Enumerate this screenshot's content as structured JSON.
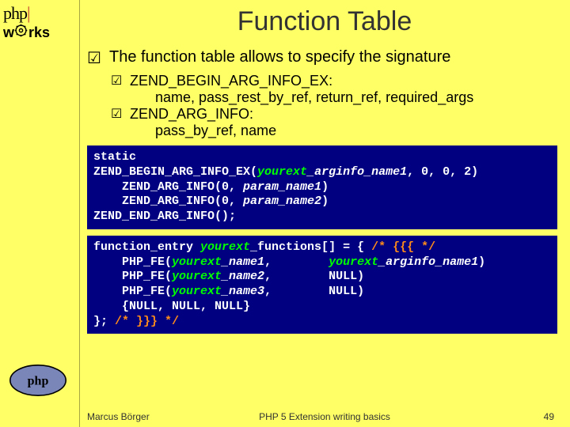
{
  "header": {
    "logo_php": "php",
    "logo_pipe": "|",
    "logo_works": "rks"
  },
  "title": "Function Table",
  "main_point": "The function table allows to specify the signature",
  "sub_points": [
    {
      "head": "ZEND_BEGIN_ARG_INFO_EX:",
      "detail": "name, pass_rest_by_ref, return_ref, required_args"
    },
    {
      "head": "ZEND_ARG_INFO:",
      "detail": "pass_by_ref, name"
    }
  ],
  "code1": {
    "l1": "static",
    "l2a": "ZEND_BEGIN_ARG_INFO_EX(",
    "l2b": "yourext",
    "l2c": "_arginfo_name1",
    "l2d": ", 0, 0, 2)",
    "l3a": "    ZEND_ARG_INFO(0, ",
    "l3b": "param_name1",
    "l3c": ")",
    "l4a": "    ZEND_ARG_INFO(0, ",
    "l4b": "param_name2",
    "l4c": ")",
    "l5": "ZEND_END_ARG_INFO();"
  },
  "code2": {
    "l1a": "function_entry ",
    "l1b": "yourext",
    "l1c": "_functions[] = { ",
    "l1d": "/* {{{ */",
    "l2a": "    PHP_FE(",
    "l2b": "yourext",
    "l2c": "_name1",
    "l2d": ",        ",
    "l2e": "yourext",
    "l2f": "_arginfo_name1",
    "l2g": ")",
    "l3a": "    PHP_FE(",
    "l3b": "yourext",
    "l3c": "_name2",
    "l3d": ",        NULL)",
    "l4a": "    PHP_FE(",
    "l4b": "yourext",
    "l4c": "_name3",
    "l4d": ",        NULL)",
    "l5": "    {NULL, NULL, NULL}",
    "l6a": "}; ",
    "l6b": "/* }}} */"
  },
  "footer": {
    "author": "Marcus Börger",
    "title": "PHP 5 Extension writing basics",
    "page": "49"
  }
}
